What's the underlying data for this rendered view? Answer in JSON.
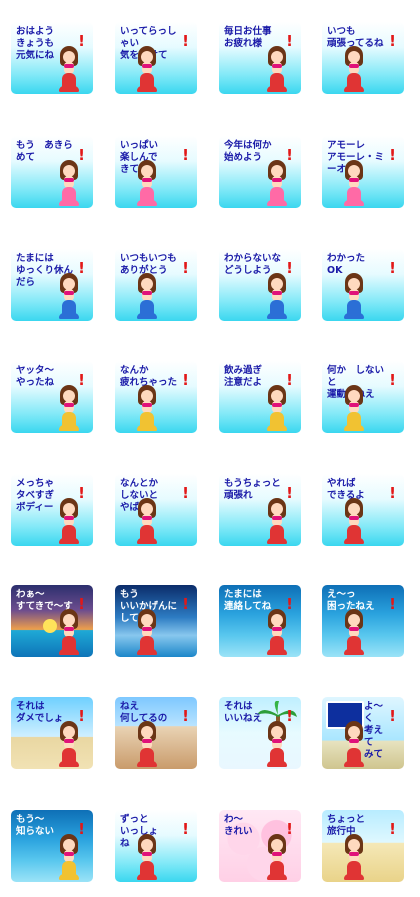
{
  "palette": {
    "text_blue": "#1a1aa8",
    "exclaim_red": "#e21818",
    "hair_brown": "#6b3516",
    "bikini_pink": "#e0117a",
    "tail_red": "#e03434",
    "tail_pink": "#ff6aa6",
    "tail_blue": "#2b6fd6",
    "tail_yellow": "#f1c232"
  },
  "stickers": [
    {
      "id": "r1c1",
      "text": "おはよう\nきょうも\n元気にね",
      "bg": "sky",
      "tail": "#e03434"
    },
    {
      "id": "r1c2",
      "text": "いってらっしゃい\n気を付けて",
      "bg": "sky",
      "tail": "#e03434"
    },
    {
      "id": "r1c3",
      "text": "毎日お仕事\nお疲れ様",
      "bg": "sky",
      "tail": "#e03434"
    },
    {
      "id": "r1c4",
      "text": "いつも\n頑張ってるね",
      "bg": "sky",
      "tail": "#e03434"
    },
    {
      "id": "r2c1",
      "text": "もう　あきらめて",
      "bg": "sky",
      "tail": "#ff6aa6"
    },
    {
      "id": "r2c2",
      "text": "いっぱい\n楽しんで\nきてね",
      "bg": "sky",
      "tail": "#ff6aa6"
    },
    {
      "id": "r2c3",
      "text": "今年は何か\n始めよう",
      "bg": "sky",
      "tail": "#ff6aa6"
    },
    {
      "id": "r2c4",
      "text": "アモーレ\nアモーレ・ミーオ",
      "bg": "sky",
      "tail": "#ff6aa6"
    },
    {
      "id": "r3c1",
      "text": "たまには\nゆっくり休んだら",
      "bg": "sky",
      "tail": "#2b6fd6"
    },
    {
      "id": "r3c2",
      "text": "いつもいつも\nありがとう",
      "bg": "sky",
      "tail": "#2b6fd6"
    },
    {
      "id": "r3c3",
      "text": "わからないな\nどうしよう",
      "bg": "sky",
      "tail": "#2b6fd6"
    },
    {
      "id": "r3c4",
      "text": "わかった\nOK",
      "bg": "sky",
      "tail": "#2b6fd6"
    },
    {
      "id": "r4c1",
      "text": "ヤッタ〜\nやったね",
      "bg": "sky",
      "tail": "#f1c232"
    },
    {
      "id": "r4c2",
      "text": "なんか\n疲れちゃった",
      "bg": "sky",
      "tail": "#f1c232"
    },
    {
      "id": "r4c3",
      "text": "飲み過ぎ\n注意だよ",
      "bg": "sky",
      "tail": "#f1c232"
    },
    {
      "id": "r4c4",
      "text": "何か　しないと\n運動　ねえ",
      "bg": "sky",
      "tail": "#f1c232"
    },
    {
      "id": "r5c1",
      "text": "メっちゃ\nタベすぎ\nボディー",
      "bg": "sky",
      "tail": "#e03434"
    },
    {
      "id": "r5c2",
      "text": "なんとか\nしないと\nやばい",
      "bg": "sky",
      "tail": "#e03434"
    },
    {
      "id": "r5c3",
      "text": "もうちょっと\n頑張れ",
      "bg": "sky",
      "tail": "#e03434"
    },
    {
      "id": "r5c4",
      "text": "やれば\nできるよ",
      "bg": "sky",
      "tail": "#e03434"
    },
    {
      "id": "r6c1",
      "text": "わぁ〜\nすてきで〜す",
      "bg": "sunset",
      "tail": "#e03434"
    },
    {
      "id": "r6c2",
      "text": "もう\nいいかげんに\nして",
      "bg": "city",
      "tail": "#e03434"
    },
    {
      "id": "r6c3",
      "text": "たまには\n連絡してね",
      "bg": "ocean",
      "tail": "#e03434"
    },
    {
      "id": "r6c4",
      "text": "え〜っ\n困ったねえ",
      "bg": "ocean",
      "tail": "#e03434"
    },
    {
      "id": "r7c1",
      "text": "それは\nダメでしょ",
      "bg": "beach",
      "tail": "#e03434"
    },
    {
      "id": "r7c2",
      "text": "ねえ\n何してるの",
      "bg": "checker",
      "tail": "#e03434"
    },
    {
      "id": "r7c3",
      "text": "それは\nいいねえ",
      "bg": "palm",
      "tail": "#e03434"
    },
    {
      "id": "r7c4",
      "text": "よ〜く\n考えて\nみて",
      "bg": "sign",
      "tail": "#e03434"
    },
    {
      "id": "r8c1",
      "text": "もう〜\n知らない",
      "bg": "ocean",
      "tail": "#f1c232"
    },
    {
      "id": "r8c2",
      "text": "ずっと\nいっしょ\nね",
      "bg": "sky",
      "tail": "#e03434"
    },
    {
      "id": "r8c3",
      "text": "わ〜\nきれい",
      "bg": "blossom",
      "tail": "#e03434"
    },
    {
      "id": "r8c4",
      "text": "ちょっと\n旅行中",
      "bg": "sandsea",
      "tail": "#e03434"
    }
  ]
}
